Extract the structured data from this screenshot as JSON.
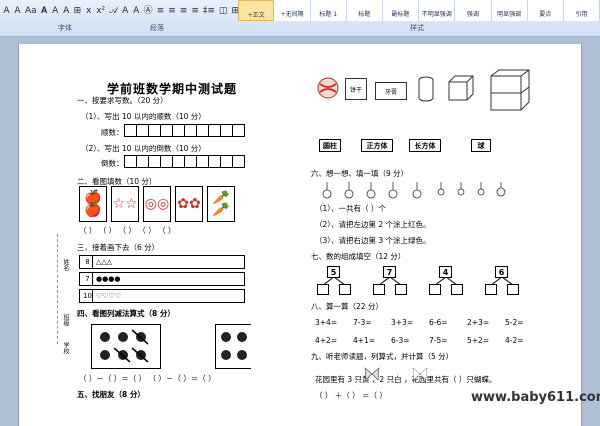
{
  "ribbon": {
    "font_group": "字体",
    "paragraph_group": "段落",
    "styles_group": "样式",
    "toolbar": [
      "A",
      "A",
      "Aa",
      "𝐀",
      "A",
      "A",
      "⊞",
      "x",
      "x²",
      "𝒜",
      "A",
      "A",
      "Ⓐ",
      "≡",
      "≡",
      "≡",
      "≡",
      "‡≡",
      "◫",
      "⊞"
    ],
    "styles": [
      "+正文",
      "+无间隔",
      "标题 1",
      "标题",
      "副标题",
      "不明显强调",
      "强调",
      "明显强调",
      "要点",
      "引用"
    ]
  },
  "doc": {
    "title": "学前班数学期中测试题",
    "s1": "一、按要求写数。（20 分）",
    "s1a": "（1）、写出 10 以内的顺数（10 分）",
    "s1a_label": "顺数：",
    "s1b": "（2）、写出 10 以内的倒数（10 分）",
    "s1b_label": "倒数：",
    "s2": "二、看图填数（10 分）",
    "s2_pictures": [
      "🍎",
      "☆",
      "◎",
      "✿",
      "🥕"
    ],
    "paren_row": "（    ）    （    ）    （    ）    （    ）    （    ）",
    "s3": "三、接着画下去（6 分）",
    "seq": [
      {
        "num": "8",
        "marks": "△△△"
      },
      {
        "num": "7",
        "marks": "●●●●"
      },
      {
        "num": "10",
        "marks": "♡♡♡♡"
      }
    ],
    "s4": "四、看图列减法算式（8 分）",
    "s4_formula": "（   ）－（   ）＝（   ）    （   ）－（   ）＝（   ）",
    "s5": "五、找朋友（8 分）",
    "side_labels": [
      "姓名",
      "班级",
      "学校"
    ],
    "shape_words": [
      "饼干",
      "牙膏"
    ],
    "shape_labels": [
      "圆柱",
      "正方体",
      "长方体",
      "球"
    ],
    "s6": "六、想一想、填一填（9 分）",
    "s6_1": "（1）、一共有（    ）个",
    "s6_2": "（2）、请把左边第 2 个涂上红色。",
    "s6_3": "（3）、请把右边第 3 个涂上绿色。",
    "s7": "七、数的组成填空（12 分）",
    "s7_nums": [
      "5",
      "7",
      "4",
      "6"
    ],
    "s8": "八、算一算（22 分）",
    "calc_rows": [
      [
        "3+4=",
        "7-3=",
        "3+3=",
        "6-6=",
        "2+3=",
        "5-2="
      ],
      [
        "4+2=",
        "4+1=",
        "6-3=",
        "7-5=",
        "5+2=",
        "4-2="
      ]
    ],
    "s9": "九、听老师读题，列算式，并计算（5 分）",
    "s9_text": "花园里有 3 只黄      ，2 只白      ，花园里共有（    ）只蝴蝶。",
    "s9_formula": "（    ）  ＋（    ）  ＝（    ）",
    "watermark": "www.baby611.com"
  }
}
